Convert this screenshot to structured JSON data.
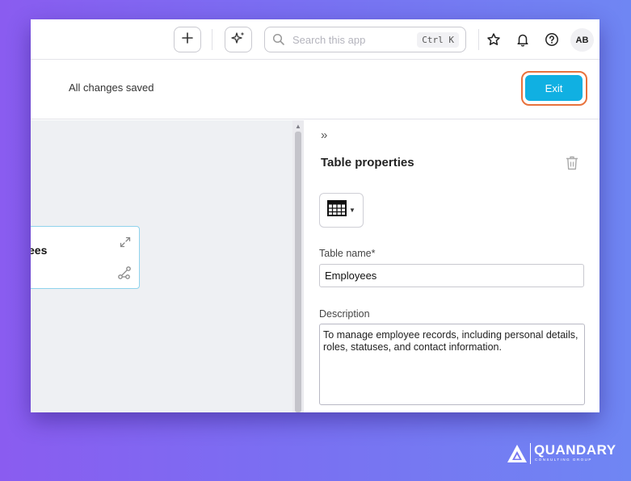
{
  "topbar": {
    "search_placeholder": "Search this app",
    "search_shortcut": "Ctrl K",
    "avatar_initials": "AB"
  },
  "header": {
    "status_text": "All changes saved",
    "exit_label": "Exit"
  },
  "canvas": {
    "card_title_fragment": "ees"
  },
  "panel": {
    "title": "Table properties",
    "table_name_label": "Table name*",
    "table_name_value": "Employees",
    "description_label": "Description",
    "description_value": "To manage employee records, including personal details, roles, statuses, and contact information."
  },
  "logo": {
    "name": "QUANDARY",
    "tagline": "CONSULTING GROUP"
  },
  "colors": {
    "accent": "#10b0e2",
    "highlight_ring": "#e8723c",
    "background_gradient_start": "#8a5cf0",
    "background_gradient_end": "#6f86f3"
  },
  "icons": [
    "plus-icon",
    "sparkle-icon",
    "search-icon",
    "star-icon",
    "bell-icon",
    "help-icon",
    "expand-icon",
    "relation-icon",
    "collapse-panel-icon",
    "trash-icon",
    "table-icon"
  ]
}
